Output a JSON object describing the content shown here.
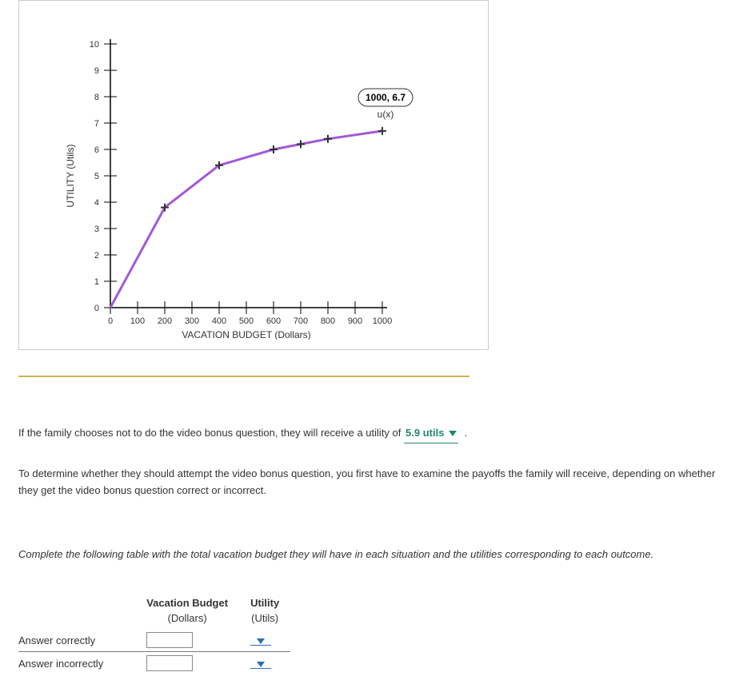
{
  "chart_data": {
    "type": "line",
    "title": "",
    "xlabel": "VACATION BUDGET (Dollars)",
    "ylabel": "UTILITY (Utils)",
    "xlim": [
      0,
      1000
    ],
    "ylim": [
      0,
      10
    ],
    "x_ticks": [
      0,
      100,
      200,
      300,
      400,
      500,
      600,
      700,
      800,
      900,
      1000
    ],
    "y_ticks": [
      0,
      1,
      2,
      3,
      4,
      5,
      6,
      7,
      8,
      9,
      10
    ],
    "series": [
      {
        "name": "u(x)",
        "x": [
          0,
          200,
          400,
          600,
          700,
          800,
          1000
        ],
        "values": [
          0,
          3.8,
          5.4,
          6.0,
          6.2,
          6.4,
          6.7
        ]
      }
    ],
    "annotation": {
      "x": 1000,
      "y": 6.7,
      "label": "1000, 6.7"
    },
    "legend_label": "u(x)"
  },
  "q1": {
    "text_pre": "If the family chooses not to do the video bonus question, they will receive a utility of",
    "dropdown_value": "5.9 utils",
    "text_post": "."
  },
  "q2": {
    "text": "To determine whether they should attempt the video bonus question, you first have to examine the payoffs the family will receive, depending on whether they get the video bonus question correct or incorrect."
  },
  "q3": {
    "prompt": "Complete the following table with the total vacation budget they will have in each situation and the utilities corresponding to each outcome.",
    "headers": {
      "col1": "Vacation Budget",
      "col1_sub": "(Dollars)",
      "col2": "Utility",
      "col2_sub": "(Utils)"
    },
    "rows": [
      {
        "label": "Answer correctly",
        "budget": "",
        "utility": ""
      },
      {
        "label": "Answer incorrectly",
        "budget": "",
        "utility": ""
      }
    ]
  }
}
